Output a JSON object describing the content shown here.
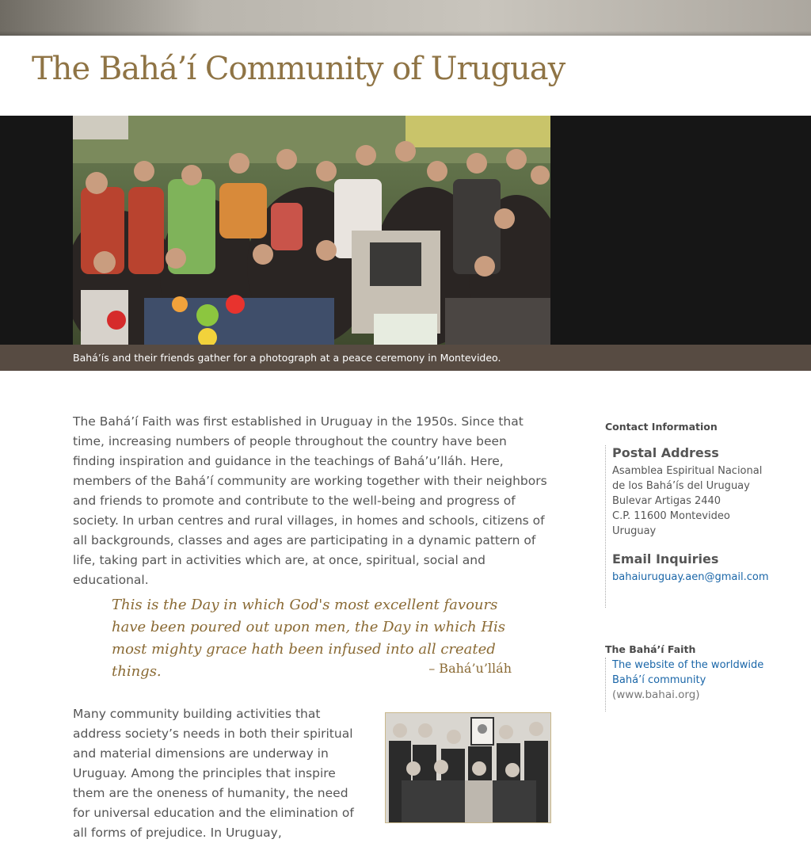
{
  "site": {
    "title": "The Bahá’í Community of Uruguay"
  },
  "hero": {
    "caption": "Bahá’ís and their friends gather for a photograph at a peace ceremony in Montevideo."
  },
  "main": {
    "paragraph1": "The Bahá’í Faith was first established in Uruguay in the 1950s. Since that time, increasing numbers of people throughout the country have been finding inspiration and guidance in the teachings of Bahá’u’lláh. Here, members of the Bahá’í community are working together with their neighbors and friends to promote and contribute to the well-being and progress of society. In urban centres and rural villages, in homes and schools, citizens of all backgrounds, classes and ages are participating in a dynamic pattern of life, taking part in activities which are, at once, spiritual, social and educational.",
    "quote": "This is the Day in which God's most excellent favours have been poured out upon men, the Day in which His most mighty grace hath been infused into all created things.",
    "quote_attribution": "– Bahá’u’lláh",
    "paragraph2": "Many community building activities that address society’s needs in both their spiritual and material dimensions are underway in Uruguay. Among the principles that inspire them are the oneness of humanity, the need for universal education and the elimination of all forms of prejudice. In Uruguay,"
  },
  "sidebar": {
    "contact_heading": "Contact Information",
    "postal_heading": "Postal Address",
    "postal_lines": [
      "Asamblea Espiritual Nacional",
      "de los Bahá’ís del Uruguay",
      "Bulevar Artigas 2440",
      "C.P. 11600 Montevideo",
      "Uruguay"
    ],
    "email_heading": "Email Inquiries",
    "email": "bahaiuruguay.aen@gmail.com",
    "faith_heading": "The Bahá’í Faith",
    "faith_link": "The website of the worldwide Bahá’í community",
    "faith_url_text": "(www.bahai.org)"
  },
  "colors": {
    "title_brown": "#8f7445",
    "caption_bar": "#574b42",
    "link_blue": "#1a66a8",
    "quote_gold": "#8a6a34"
  }
}
